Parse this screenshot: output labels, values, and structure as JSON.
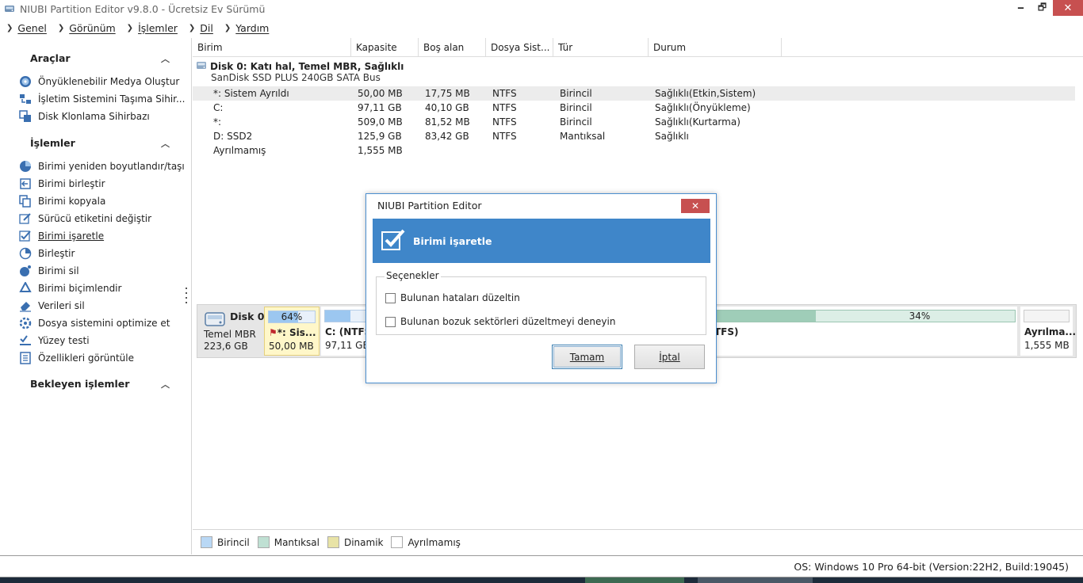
{
  "window": {
    "title": "NIUBI Partition Editor v9.8.0 - Ücretsiz Ev Sürümü",
    "minimize": "🗕",
    "maximize": "🗗",
    "close": "✕"
  },
  "menu": [
    {
      "label": "Genel"
    },
    {
      "label": "Görünüm"
    },
    {
      "label": "İşlemler"
    },
    {
      "label": "Dil"
    },
    {
      "label": "Yardım"
    }
  ],
  "sidebar": {
    "tools_title": "Araçlar",
    "tools": [
      {
        "label": "Önyüklenebilir Medya Oluştur",
        "icon": "disc-icon"
      },
      {
        "label": "İşletim Sistemini Taşıma Sihir...",
        "icon": "migrate-icon"
      },
      {
        "label": "Disk Klonlama Sihirbazı",
        "icon": "clone-icon"
      }
    ],
    "ops_title": "İşlemler",
    "ops": [
      {
        "label": "Birimi yeniden boyutlandır/taşı",
        "icon": "resize-icon"
      },
      {
        "label": "Birimi birleştir",
        "icon": "merge-icon"
      },
      {
        "label": "Birimi kopyala",
        "icon": "copy-icon"
      },
      {
        "label": "Sürücü etiketini değiştir",
        "icon": "edit-icon"
      },
      {
        "label": "Birimi işaretle",
        "icon": "check-icon"
      },
      {
        "label": "Birleştir",
        "icon": "defrag-icon"
      },
      {
        "label": "Birimi sil",
        "icon": "delete-icon"
      },
      {
        "label": "Birimi biçimlendir",
        "icon": "format-icon"
      },
      {
        "label": "Verileri sil",
        "icon": "eraser-icon"
      },
      {
        "label": "Dosya sistemini optimize et",
        "icon": "optimize-icon"
      },
      {
        "label": "Yüzey testi",
        "icon": "surface-test-icon"
      },
      {
        "label": "Özellikleri görüntüle",
        "icon": "properties-icon"
      }
    ],
    "pending_title": "Bekleyen işlemler"
  },
  "table": {
    "headers": [
      "Birim",
      "Kapasite",
      "Boş alan",
      "Dosya Sist...",
      "Tür",
      "Durum"
    ],
    "disk_title": "Disk 0: Katı hal, Temel MBR, Sağlıklı",
    "disk_model": "SanDisk SSD PLUS 240GB SATA Bus",
    "rows": [
      {
        "volume": "*: Sistem Ayrıldı",
        "capacity": "50,00 MB",
        "free": "17,75 MB",
        "fs": "NTFS",
        "type": "Birincil",
        "status": "Sağlıklı(Etkin,Sistem)"
      },
      {
        "volume": "C:",
        "capacity": "97,11 GB",
        "free": "40,10 GB",
        "fs": "NTFS",
        "type": "Birincil",
        "status": "Sağlıklı(Önyükleme)"
      },
      {
        "volume": "*:",
        "capacity": "509,0 MB",
        "free": "81,52 MB",
        "fs": "NTFS",
        "type": "Birincil",
        "status": "Sağlıklı(Kurtarma)"
      },
      {
        "volume": "D: SSD2",
        "capacity": "125,9 GB",
        "free": "83,42 GB",
        "fs": "NTFS",
        "type": "Mantıksal",
        "status": "Sağlıklı"
      },
      {
        "volume": "Ayrılmamış",
        "capacity": "1,555 MB",
        "free": "",
        "fs": "",
        "type": "",
        "status": ""
      }
    ]
  },
  "diskmap": {
    "name": "Disk 0",
    "type": "Temel MBR",
    "size": "223,6 GB",
    "partitions": [
      {
        "pct": "64%",
        "used": 0.64,
        "label": "*: Sis...",
        "size": "50,00 MB"
      },
      {
        "pct": "",
        "used": 0.59,
        "label": "C: (NTFS)",
        "size": "97,11 GB"
      },
      {
        "pct": "34%",
        "used": 0.34,
        "label": "TFS)",
        "size": ""
      },
      {
        "pct": "",
        "used": 0,
        "label": "Ayrılma...",
        "size": "1,555 MB"
      }
    ]
  },
  "legend": [
    {
      "label": "Birincil",
      "color": "#b9d8f5"
    },
    {
      "label": "Mantıksal",
      "color": "#bfe0d3"
    },
    {
      "label": "Dinamik",
      "color": "#e8e3a6"
    },
    {
      "label": "Ayrılmamış",
      "color": "#ffffff"
    }
  ],
  "status": {
    "os": "OS: Windows 10 Pro 64-bit (Version:22H2, Build:19045)"
  },
  "dialog": {
    "title": "NIUBI Partition Editor",
    "close": "✕",
    "banner_title": "Birimi işaretle",
    "group_label": "Seçenekler",
    "option1": "Bulunan hataları düzeltin",
    "option2": "Bulunan bozuk sektörleri düzeltmeyi deneyin",
    "ok": "Tamam",
    "cancel": "İptal"
  }
}
